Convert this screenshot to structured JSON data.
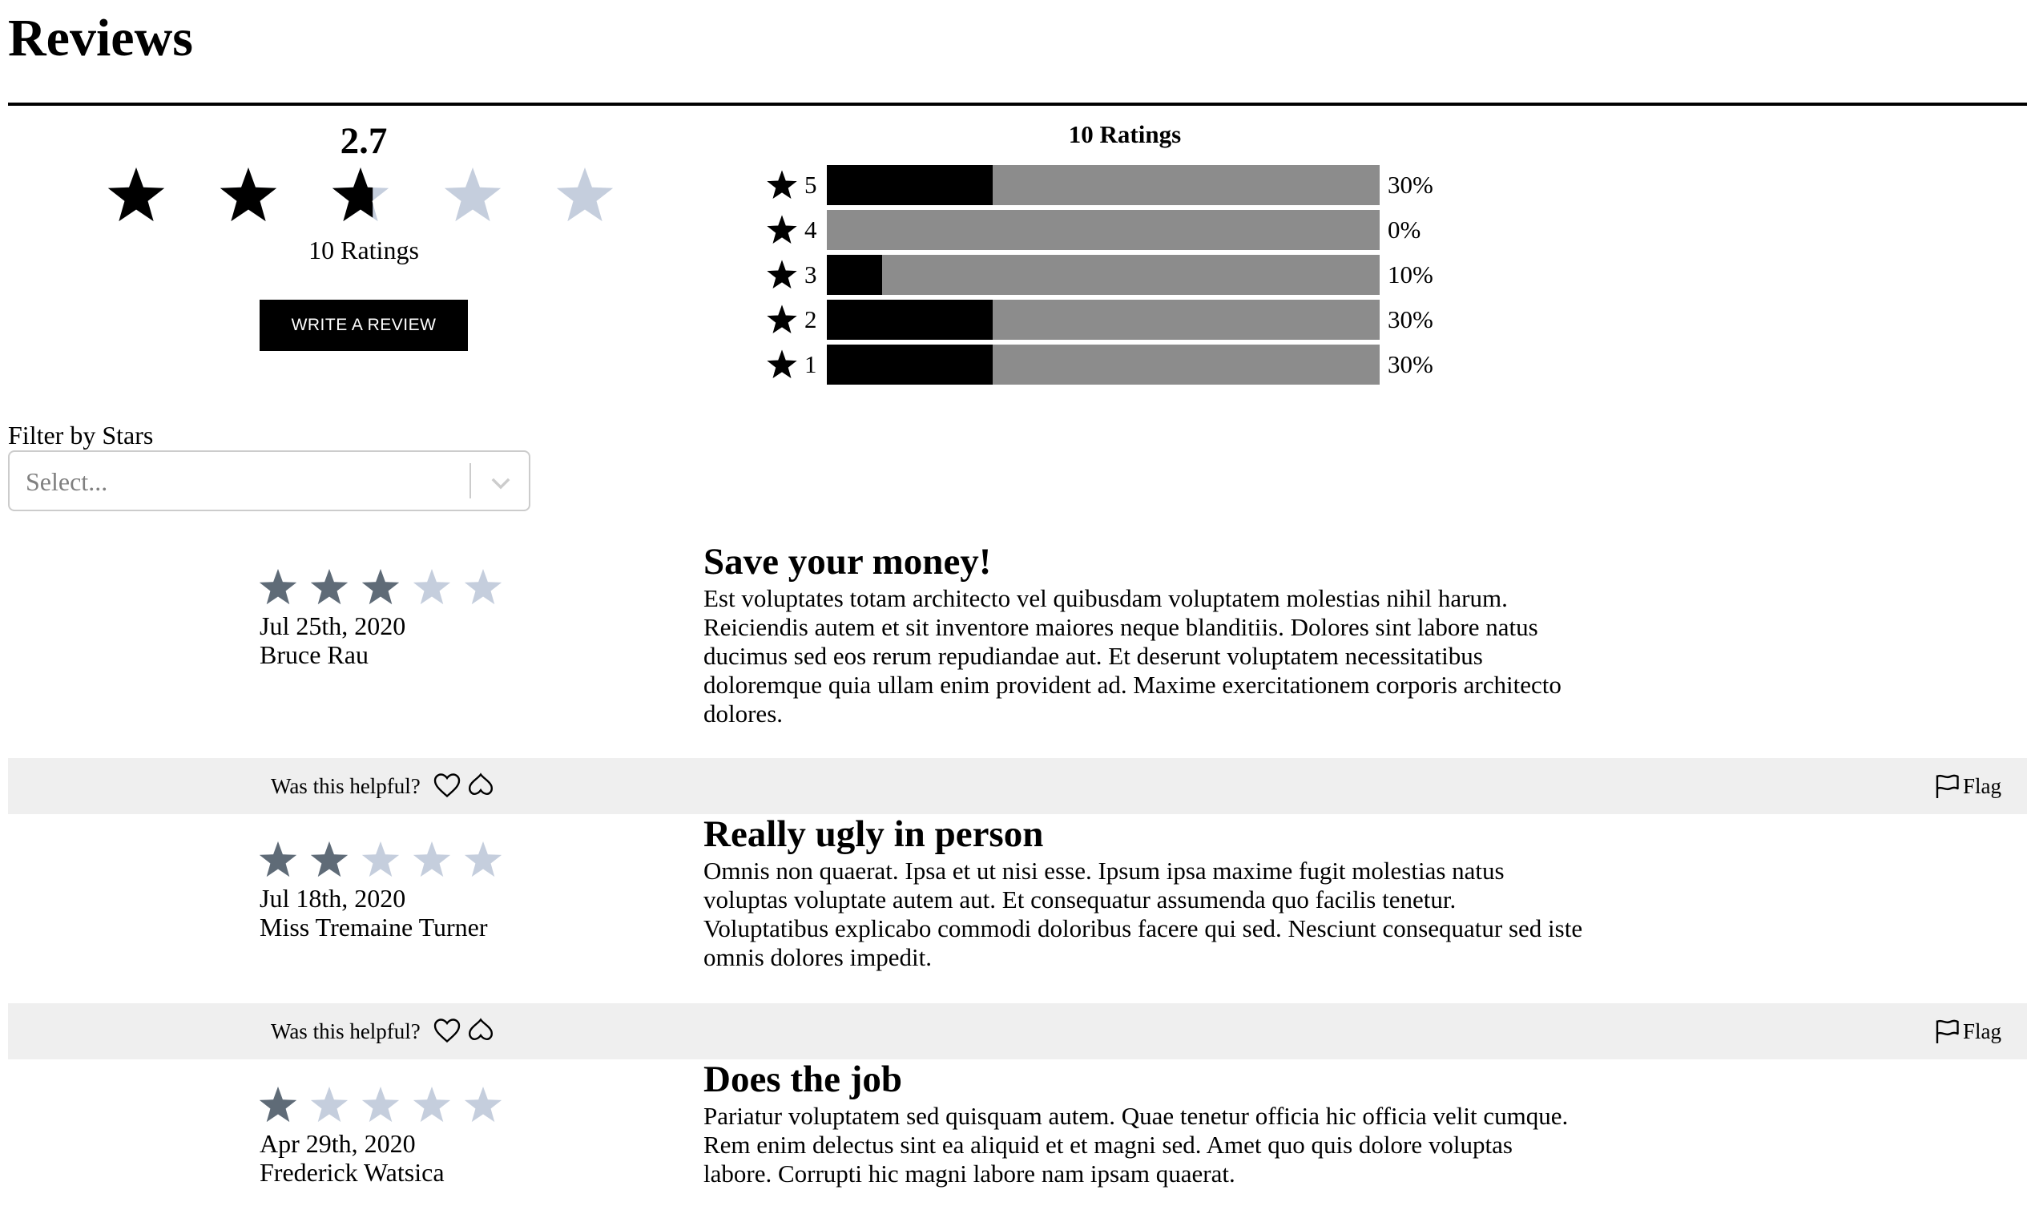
{
  "page_title": "Reviews",
  "summary": {
    "average": "2.7",
    "average_value": 2.7,
    "max_stars": 5,
    "ratings_count_label": "10 Ratings",
    "write_review_label": "WRITE A REVIEW"
  },
  "breakdown": {
    "title": "10 Ratings",
    "rows": [
      {
        "stars": "5",
        "percent_label": "30%",
        "fraction": 0.3
      },
      {
        "stars": "4",
        "percent_label": "0%",
        "fraction": 0.0
      },
      {
        "stars": "3",
        "percent_label": "10%",
        "fraction": 0.1
      },
      {
        "stars": "2",
        "percent_label": "30%",
        "fraction": 0.3
      },
      {
        "stars": "1",
        "percent_label": "30%",
        "fraction": 0.3
      }
    ]
  },
  "filter": {
    "label": "Filter by Stars",
    "placeholder": "Select..."
  },
  "reviews": [
    {
      "rating": 3,
      "date": "Jul 25th, 2020",
      "author": "Bruce Rau",
      "title": "Save your money!",
      "body": "Est voluptates totam architecto vel quibusdam voluptatem molestias nihil harum. Reiciendis autem et sit inventore maiores neque blanditiis. Dolores sint labore natus ducimus sed eos rerum repudiandae aut. Et deserunt voluptatem necessitatibus doloremque quia ullam enim provident ad. Maxime exercitationem corporis architecto dolores.",
      "helpful_label": "Was this helpful?",
      "flag_label": "Flag"
    },
    {
      "rating": 2,
      "date": "Jul 18th, 2020",
      "author": "Miss Tremaine Turner",
      "title": "Really ugly in person",
      "body": "Omnis non quaerat. Ipsa et ut nisi esse. Ipsum ipsa maxime fugit molestias natus voluptas voluptate autem aut. Et consequatur assumenda quo facilis tenetur. Voluptatibus explicabo commodi doloribus facere qui sed. Nesciunt consequatur sed iste omnis dolores impedit.",
      "helpful_label": "Was this helpful?",
      "flag_label": "Flag"
    },
    {
      "rating": 1,
      "date": "Apr 29th, 2020",
      "author": "Frederick Watsica",
      "title": "Does the job",
      "body": "Pariatur voluptatem sed quisquam autem. Quae tenetur officia hic officia velit cumque. Rem enim delectus sint ea aliquid et et magni sed. Amet quo quis dolore voluptas labore. Corrupti hic magni labore nam ipsam quaerat.",
      "helpful_label": "",
      "flag_label": ""
    }
  ],
  "colors": {
    "summary_star_filled": "#000000",
    "summary_star_empty": "#c5cedd",
    "review_star_filled": "#5f6b77",
    "review_star_empty": "#c5cedd",
    "bar_fill": "#000000",
    "bar_track": "#8c8c8c",
    "helpful_bar_bg": "#efefef"
  },
  "icons": {
    "summary_star": "star-icon",
    "breakdown_star": "star-icon",
    "filter_chevron": "chevron-down-icon",
    "helpful_yes": "heart-icon",
    "helpful_no": "thumb-down-outline-icon",
    "flag": "flag-icon"
  }
}
